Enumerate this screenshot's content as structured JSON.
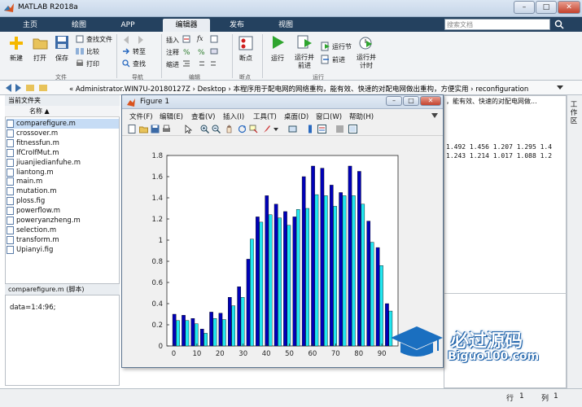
{
  "window": {
    "title": "MATLAB R2018a",
    "controls": [
      "–",
      "□",
      "✕"
    ]
  },
  "tabs": [
    "主页",
    "绘图",
    "APP",
    "编辑器",
    "发布",
    "视图"
  ],
  "active_tab": "编辑器",
  "search": {
    "placeholder": "搜索文档"
  },
  "toolstrip": {
    "file": {
      "new": "新建",
      "open": "打开",
      "save": "保存",
      "find_files": "查找文件",
      "compare": "比较",
      "print": "打印",
      "group": "文件"
    },
    "navigate": {
      "goto": "转至",
      "find": "查找",
      "group": "导航"
    },
    "edit": {
      "insert": "插入",
      "comment": "注释",
      "indent": "缩进",
      "fx": "fx",
      "group": "编辑"
    },
    "breakpoints": {
      "label": "断点",
      "group": "断点"
    },
    "run": {
      "run": "运行",
      "run_advance": "运行并\n前进",
      "run_section": "运行节",
      "advance": "前进",
      "run_time": "运行并\n计时",
      "group": "运行"
    }
  },
  "address": {
    "path": "« Administrator.WIN7U-20180127Z  ›  Desktop  ›  本程序用于配电网的网络重构，能有效、快速的对配电网做出重构，方便实用  ›  reconfiguration"
  },
  "current_folder": {
    "header": "当前文件夹",
    "column": "名称 ▲",
    "files": [
      "comparefigure.m",
      "crossover.m",
      "fitnessfun.m",
      "IfCroIfMut.m",
      "jiuanjiedianfuhe.m",
      "liantong.m",
      "main.m",
      "mutation.m",
      "ploss.fig",
      "powerflow.m",
      "poweryanzheng.m",
      "selection.m",
      "transform.m",
      "Upianyi.fig"
    ],
    "selected": "comparefigure.m"
  },
  "details": {
    "header": "comparefigure.m  (脚本)",
    "content": "data=1:4:96;"
  },
  "right_strip": {
    "label": "工作区"
  },
  "background": {
    "addr_tail": "，能有效、快速的对配电网做...",
    "row1": "1.492  1.456  1.207  1.295  1.4",
    "row2": "1.243  1.214  1.017  1.088  1.2"
  },
  "status": {
    "row_label": "行",
    "row": "1",
    "col_label": "列",
    "col": "1"
  },
  "figure": {
    "title": "Figure 1",
    "menus": [
      "文件(F)",
      "编辑(E)",
      "查看(V)",
      "插入(I)",
      "工具(T)",
      "桌面(D)",
      "窗口(W)",
      "帮助(H)"
    ]
  },
  "watermark": {
    "line1": "必过源码",
    "line2": "Biguo100.com"
  },
  "colors": {
    "series1": "#0000b8",
    "series2": "#22e6f0",
    "accent": "#24415f"
  },
  "chart_data": {
    "type": "bar",
    "x": [
      1,
      5,
      9,
      13,
      17,
      21,
      25,
      29,
      33,
      37,
      41,
      45,
      49,
      53,
      57,
      61,
      65,
      69,
      73,
      77,
      81,
      85,
      89,
      93
    ],
    "series": [
      {
        "values": [
          0.3,
          0.29,
          0.26,
          0.16,
          0.32,
          0.31,
          0.46,
          0.56,
          0.82,
          1.22,
          1.42,
          1.34,
          1.27,
          1.22,
          1.6,
          1.7,
          1.68,
          1.52,
          1.45,
          1.7,
          1.65,
          1.18,
          0.93,
          0.4
        ]
      },
      {
        "values": [
          0.24,
          0.24,
          0.21,
          0.12,
          0.26,
          0.25,
          0.38,
          0.46,
          1.01,
          1.17,
          1.24,
          1.21,
          1.14,
          1.29,
          1.3,
          1.43,
          1.42,
          1.32,
          1.42,
          1.42,
          1.34,
          0.98,
          0.76,
          0.33
        ]
      }
    ],
    "xlim": [
      -3,
      97
    ],
    "ylim": [
      0,
      1.8
    ],
    "xticks": [
      0,
      10,
      20,
      30,
      40,
      50,
      60,
      70,
      80,
      90
    ],
    "yticks": [
      0,
      0.2,
      0.4,
      0.6,
      0.8,
      1,
      1.2,
      1.4,
      1.6,
      1.8
    ]
  }
}
